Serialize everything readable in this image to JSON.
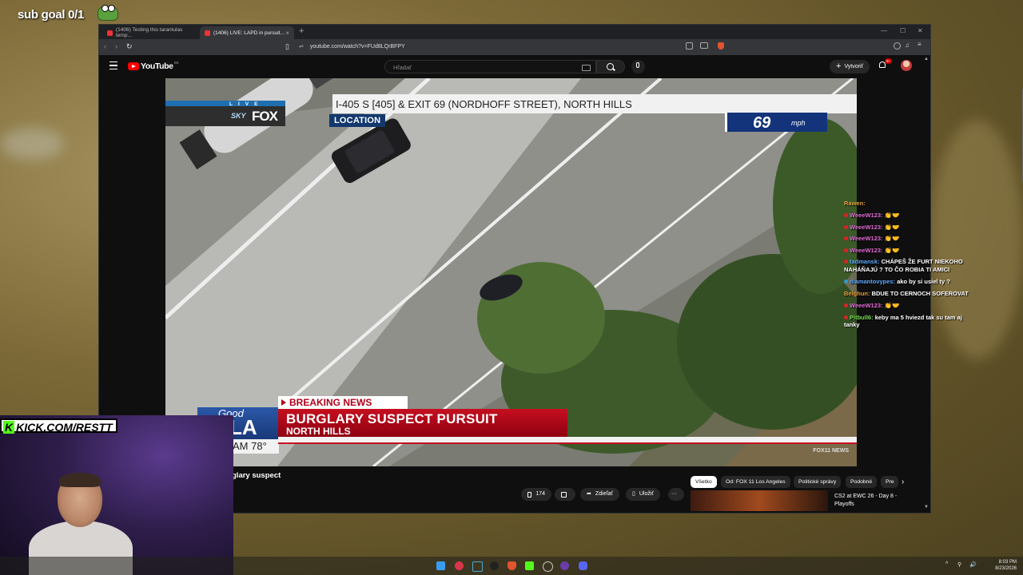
{
  "overlay": {
    "sub_goal": "sub goal 0/1",
    "kick_brand": "KICK.COM/RESTT"
  },
  "browser": {
    "tabs": [
      {
        "label": "(1406) Testing this tarantulas temp...",
        "active": false
      },
      {
        "label": "(1406) LIVE: LAPD in pursuit...",
        "active": true
      }
    ],
    "url": "youtube.com/watch?v=FUd8LQrBFPY"
  },
  "youtube": {
    "logo_text": "YouTube",
    "logo_suffix": "SK",
    "search_placeholder": "Hľadať",
    "create_label": "Vytvoriť",
    "notification_count": "9+",
    "video_title_partial": "glary suspect",
    "likes": "174",
    "share_label": "Zdieľať",
    "save_label": "Uložiť",
    "more_label": "···",
    "chips": [
      {
        "label": "Všetko",
        "active": true
      },
      {
        "label": "Od: FOX 11 Los Angeles",
        "active": false
      },
      {
        "label": "Politické správy",
        "active": false
      },
      {
        "label": "Podobné",
        "active": false
      },
      {
        "label": "Pre",
        "active": false
      }
    ],
    "recommended": {
      "title": "CS2 at EWC 26 - Day 8 - Playoffs"
    }
  },
  "video_overlay": {
    "live_label": "LIVE",
    "sky_label": "SKY",
    "fox_label": "FOX",
    "location_text": "I-405 S [405] & EXIT 69 (NORDHOFF STREET), NORTH HILLS",
    "location_label": "LOCATION",
    "speed_value": "69",
    "speed_unit": "mph",
    "breaking_label": "BREAKING NEWS",
    "headline": "BURGLARY SUSPECT PURSUIT",
    "subheadline": "NORTH HILLS",
    "good_day": "Good",
    "la": "LA",
    "weather": "AM 78°",
    "network_tag": "FOX11 NEWS"
  },
  "chat": [
    {
      "user": "Rawen:",
      "text": "",
      "color": "#e8a33c"
    },
    {
      "user": "WeeeW123:",
      "text": "👏🤝",
      "color": "#e36ad8"
    },
    {
      "user": "WeeeW123:",
      "text": "👏🤝",
      "color": "#e36ad8"
    },
    {
      "user": "WeeeW123:",
      "text": "👏🤝",
      "color": "#e36ad8"
    },
    {
      "user": "WeeeW123:",
      "text": "👏🤝",
      "color": "#e36ad8"
    },
    {
      "user": "tadmansk:",
      "text": "CHÁPEŠ ŽE FURT NIEKOHO NAHÁŇAJÚ ? TO ČO ROBIA TI AMICI",
      "color": "#5ea8ff"
    },
    {
      "user": "diamantovypes:",
      "text": "ako by si usiel ty ?",
      "color": "#5ea8ff"
    },
    {
      "user": "Belghun:",
      "text": "BDUE TO CERNOCH SOFEROVAT",
      "color": "#e8a33c"
    },
    {
      "user": "WeeeW123:",
      "text": "👏🤝",
      "color": "#e36ad8"
    },
    {
      "user": "Pitbull6:",
      "text": "keby ma 5 hviezd tak su tam aj tanky",
      "color": "#7cdd52"
    }
  ],
  "taskbar": {
    "time": "8:03 PM",
    "date": "8/23/2026"
  }
}
